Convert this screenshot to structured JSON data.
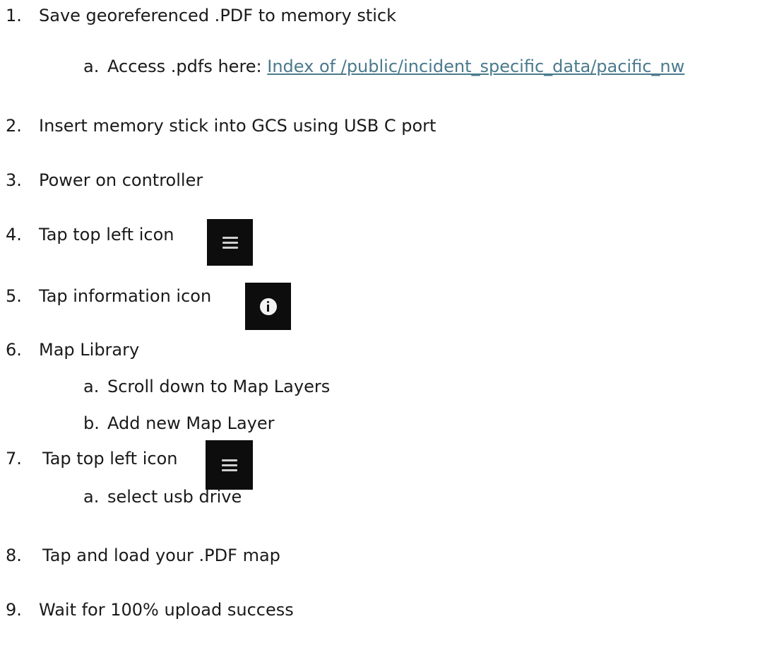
{
  "steps": [
    {
      "num": "1.",
      "text": "Save georeferenced .PDF to memory stick"
    },
    {
      "num": "2.",
      "text": "Insert memory stick into GCS using USB C port"
    },
    {
      "num": "3.",
      "text": "Power on controller"
    },
    {
      "num": "4.",
      "text": "Tap top left icon",
      "icon": "hamburger-menu-icon"
    },
    {
      "num": "5.",
      "text": "Tap information icon",
      "icon": "info-icon"
    },
    {
      "num": "6.",
      "text": "Map Library"
    },
    {
      "num": "7.",
      "text": "Tap top left icon",
      "icon": "hamburger-menu-icon"
    },
    {
      "num": "8.",
      "text": "Tap and load your .PDF map"
    },
    {
      "num": "9.",
      "text": "Wait for 100% upload success"
    }
  ],
  "substeps": {
    "step1": [
      {
        "num": "a.",
        "text": "Access .pdfs here: ",
        "link_text": "Index of /public/incident_specific_data/pacific_nw"
      }
    ],
    "step6": [
      {
        "num": "a.",
        "text": "Scroll down to Map Layers"
      },
      {
        "num": "b.",
        "text": "Add new Map Layer"
      }
    ],
    "step7": [
      {
        "num": "a.",
        "text": "select usb drive"
      }
    ]
  },
  "colors": {
    "text": "#1a1a1a",
    "link": "#4a7a8c",
    "icon_bg": "#0d0d0d"
  }
}
